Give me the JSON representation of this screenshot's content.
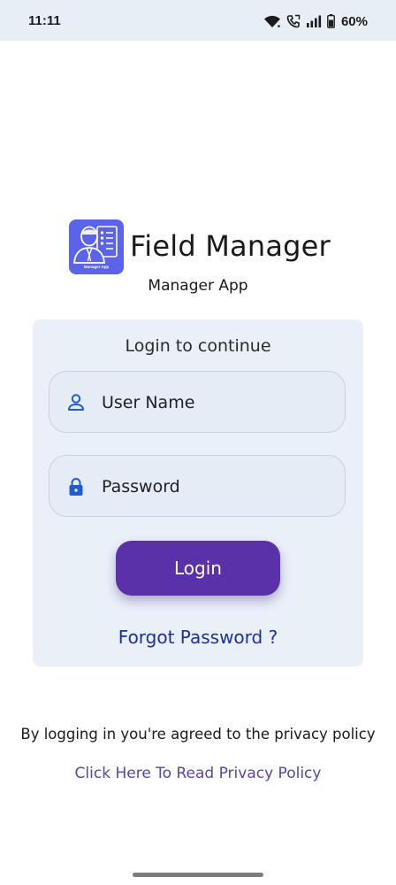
{
  "status_bar": {
    "time": "11:11",
    "battery": "60%",
    "icons": [
      "wifi-icon",
      "call-icon",
      "signal-icon",
      "battery-icon"
    ]
  },
  "app": {
    "logo_caption": "Manager App",
    "title": "Field Manager",
    "subtitle": "Manager App"
  },
  "login_card": {
    "heading": "Login to continue",
    "username": {
      "placeholder": "User Name",
      "value": "",
      "icon": "person-icon"
    },
    "password": {
      "placeholder": "Password",
      "value": "",
      "icon": "lock-icon"
    },
    "login_label": "Login",
    "forgot_label": "Forgot Password ?"
  },
  "footer": {
    "policy_note": "By logging in you're agreed to the privacy policy",
    "policy_link": "Click Here To Read Privacy Policy"
  },
  "colors": {
    "status_bar_bg": "#e8eef6",
    "logo_bg": "#5b63ea",
    "card_bg": "#eaf0f8",
    "input_icon": "#1f5bd6",
    "login_button": "#5a31a8",
    "forgot_link": "#1a2fa8",
    "policy_link": "#5a44a8"
  }
}
